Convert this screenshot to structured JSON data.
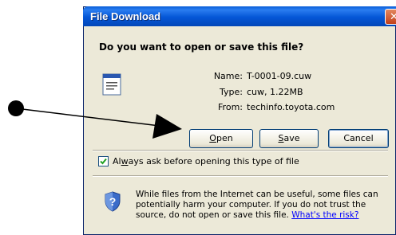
{
  "dialog": {
    "title": "File Download",
    "close_glyph": "✕",
    "question": "Do you want to open or save this file?",
    "file": {
      "icon": "document-file-icon",
      "name_label": "Name:",
      "name_value": "T-0001-09.cuw",
      "type_label": "Type:",
      "type_value": "cuw, 1.22MB",
      "from_label": "From:",
      "from_value": "techinfo.toyota.com"
    },
    "buttons": {
      "open_u": "O",
      "open_rest": "pen",
      "save_u": "S",
      "save_rest": "ave",
      "cancel": "Cancel"
    },
    "checkbox": {
      "checked": true,
      "label_pre": "Al",
      "label_u": "w",
      "label_post": "ays ask before opening this type of file"
    },
    "warning": {
      "icon": "shield-question-icon",
      "text": "While files from the Internet can be useful, some files can potentially harm your computer. If you do not trust the source, do not open or save this file. ",
      "link": "What's the risk?"
    }
  },
  "annotation": {
    "icon": "pointer-arrow-icon"
  }
}
